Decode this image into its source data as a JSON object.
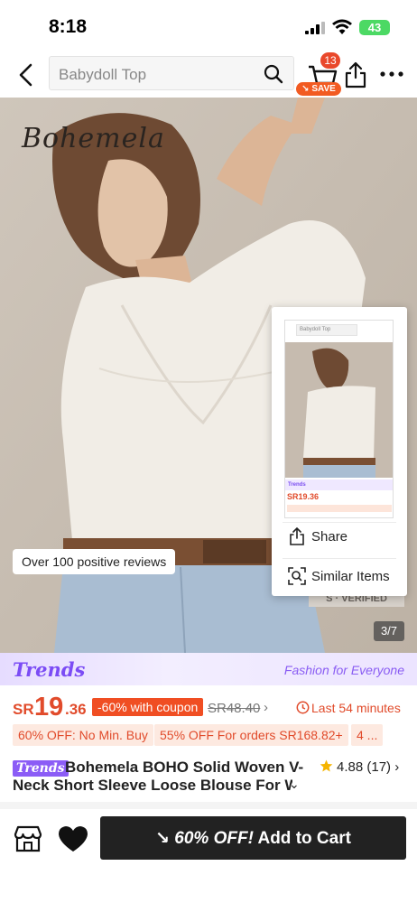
{
  "status_bar": {
    "time": "8:18",
    "battery": "43"
  },
  "header": {
    "search_text": "Babydoll Top",
    "cart_count": "13",
    "save_label": "SAVE"
  },
  "hero": {
    "brand_logo": "Bohemela",
    "reviews_chip": "Over 100 positive reviews",
    "page_indicator": "3/7",
    "verified_tag": "S · VERIFIED"
  },
  "popup": {
    "share_label": "Share",
    "similar_label": "Similar Items",
    "thumb_search": "Babydoll Top"
  },
  "trends_banner": {
    "logo": "Trends",
    "tagline": "Fashion for Everyone"
  },
  "price": {
    "currency": "SR",
    "main": "19",
    "cents": ".36",
    "discount": "-60% with coupon",
    "original": "SR48.40",
    "countdown": "Last 54 minutes"
  },
  "promos": [
    "60% OFF: No Min. Buy",
    "55% OFF For orders SR168.82+",
    "4 ..."
  ],
  "product": {
    "badge": "Trends",
    "title_line1": "Bohemela BOHO Solid Woven V-",
    "title_line2": "Neck Short Sleeve Loose Blouse For W",
    "rating": "4.88",
    "rating_count": "(17)"
  },
  "bottom_bar": {
    "promo": "60% OFF!",
    "add_to_cart": "Add to Cart"
  },
  "colors": {
    "accent_red": "#e14b2b",
    "trends_purple": "#7b4cf5",
    "button_dark": "#222222"
  }
}
